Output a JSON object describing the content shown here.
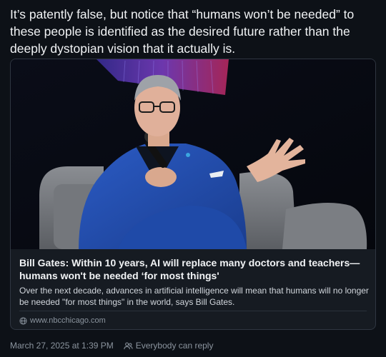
{
  "post": {
    "text": "It’s patently false, but notice that “humans won’t be needed” to these people is identified as the desired future rather than the deeply dystopian vision that it actually is."
  },
  "link_card": {
    "title": "Bill Gates: Within 10 years, AI will replace many doctors and teachers—humans won't be needed ‘for most things'",
    "description": "Over the next decade, advances in artificial intelligence will mean that humans will no longer be needed \"for most things\" in the world, says Bill Gates.",
    "domain": "www.nbcchicago.com",
    "domain_icon": "globe-icon",
    "photo_subject": "man in blue suit seated in grey armchair speaking into microphone"
  },
  "meta": {
    "timestamp": "March 27, 2025 at 1:39 PM",
    "reply_setting": "Everybody can reply",
    "reply_icon": "people-icon"
  },
  "colors": {
    "background": "#0d1117",
    "card_border": "#2f3641",
    "muted_text": "#8b949e"
  }
}
